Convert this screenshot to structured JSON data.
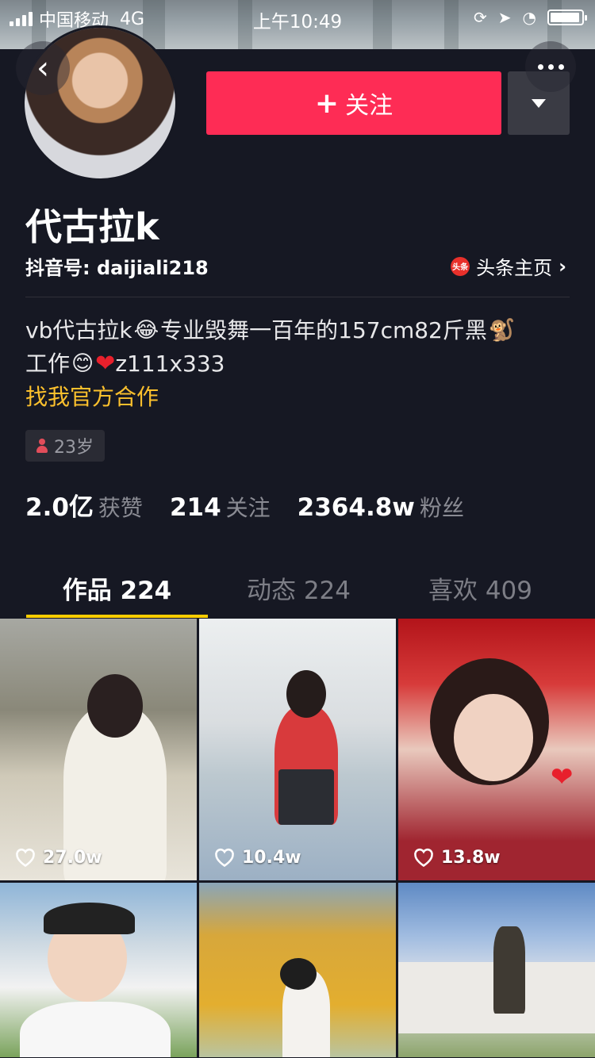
{
  "status_bar": {
    "carrier": "中国移动",
    "network": "4G",
    "time": "上午10:49"
  },
  "profile": {
    "nickname": "代古拉k",
    "douyin_id": "抖音号: daijiali218",
    "toutiao_label": "头条主页",
    "toutiao_logo_text": "头条",
    "follow_label": "关注",
    "bio": {
      "line1_a": "vb代古拉k",
      "line1_b": "专业毁舞一百年的157cm82斤黑",
      "line2_a": "工作",
      "line2_b": "z111x333",
      "business": "找我官方合作"
    },
    "age": "23岁"
  },
  "stats": [
    {
      "value": "2.0亿",
      "label": "获赞"
    },
    {
      "value": "214",
      "label": "关注"
    },
    {
      "value": "2364.8w",
      "label": "粉丝"
    }
  ],
  "tabs": [
    {
      "label": "作品 224"
    },
    {
      "label": "动态 224"
    },
    {
      "label": "喜欢 409"
    }
  ],
  "videos": [
    {
      "likes": "27.0w"
    },
    {
      "likes": "10.4w"
    },
    {
      "likes": "13.8w"
    },
    {
      "likes": ""
    },
    {
      "likes": ""
    },
    {
      "likes": ""
    }
  ],
  "icons": {
    "back": "chevron-left-icon",
    "more": "more-dots-icon",
    "dropdown": "caret-down-icon",
    "like": "heart-outline-icon"
  },
  "colors": {
    "background": "#161823",
    "follow_button": "#fe2c55",
    "business_link": "#fbc02d",
    "tab_indicator": "#facd00"
  }
}
